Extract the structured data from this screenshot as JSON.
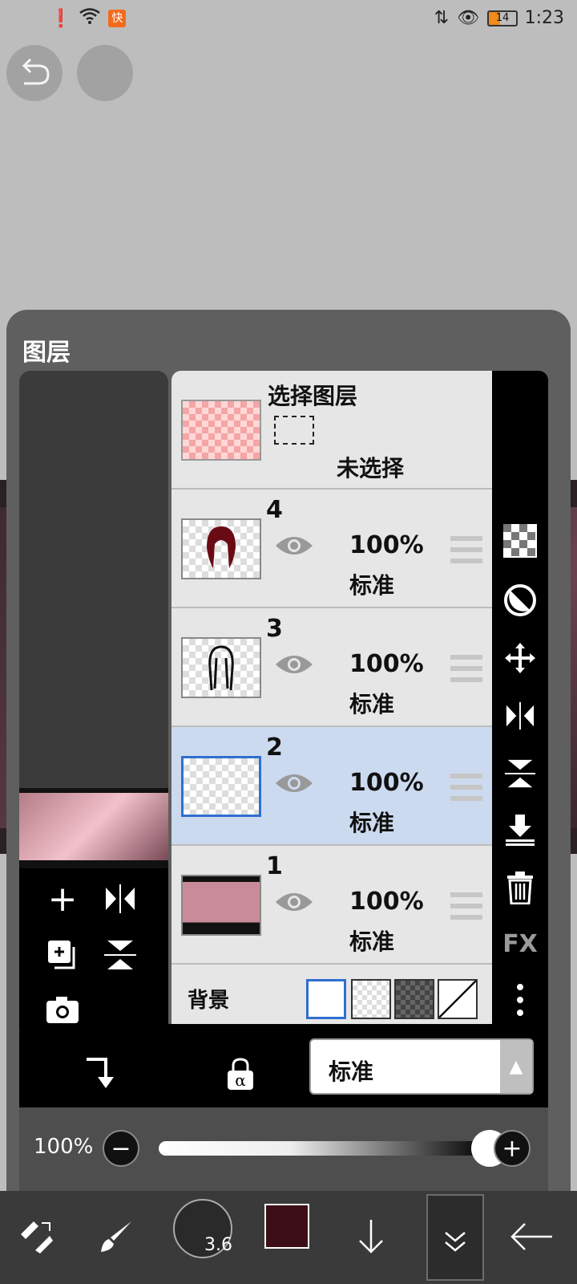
{
  "statusbar": {
    "time": "1:23",
    "battery": "14",
    "app_badge": "快"
  },
  "panel": {
    "title": "图层"
  },
  "selection": {
    "title": "选择图层",
    "status": "未选择"
  },
  "layers": [
    {
      "number": "4",
      "opacity": "100%",
      "mode": "标准"
    },
    {
      "number": "3",
      "opacity": "100%",
      "mode": "标准"
    },
    {
      "number": "2",
      "opacity": "100%",
      "mode": "标准"
    },
    {
      "number": "1",
      "opacity": "100%",
      "mode": "标准"
    }
  ],
  "background": {
    "label": "背景"
  },
  "blend": {
    "mode": "标准"
  },
  "opacity": {
    "label": "100%",
    "value": 0.95
  },
  "toolbar": {
    "brush_size": "3.6",
    "color": "#3b0e18"
  },
  "right_tools": {
    "fx_label": "FX"
  },
  "icons": {
    "undo": "undo-icon",
    "add": "plus-icon",
    "eye": "eye-icon"
  }
}
